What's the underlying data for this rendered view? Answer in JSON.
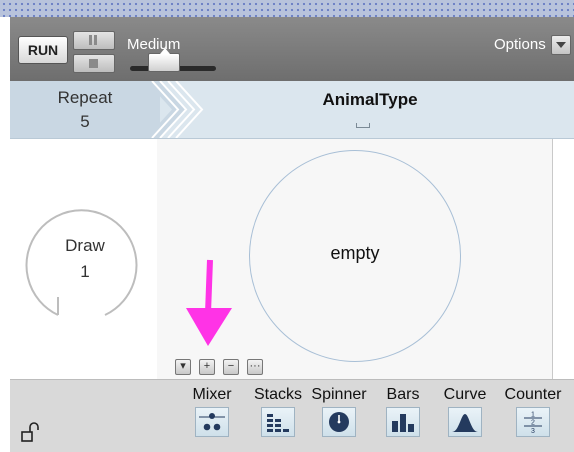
{
  "toolbar": {
    "run_label": "RUN",
    "speed_label": "Medium",
    "options_label": "Options"
  },
  "header": {
    "repeat_label": "Repeat",
    "repeat_value": "5",
    "attribute_title": "AnimalType"
  },
  "left": {
    "draw_label": "Draw",
    "draw_value": "1"
  },
  "device": {
    "content_label": "empty"
  },
  "device_buttons": [
    {
      "name": "dropdown",
      "glyph": "▾"
    },
    {
      "name": "add",
      "glyph": "+"
    },
    {
      "name": "remove",
      "glyph": "−"
    },
    {
      "name": "more",
      "glyph": "···"
    }
  ],
  "palette": {
    "items": [
      {
        "label": "Mixer",
        "icon": "mixer-icon"
      },
      {
        "label": "Stacks",
        "icon": "stacks-icon"
      },
      {
        "label": "Spinner",
        "icon": "spinner-icon"
      },
      {
        "label": "Bars",
        "icon": "bars-icon"
      },
      {
        "label": "Curve",
        "icon": "curve-icon"
      },
      {
        "label": "Counter",
        "icon": "counter-icon"
      }
    ],
    "counter_numbers": [
      "1",
      "2",
      "3"
    ]
  },
  "colors": {
    "accent_arrow": "#ff33e6",
    "header_bg": "#dbe6ee",
    "toolbar_bg": "#7c7c7c",
    "palette_icon": "#243a5e"
  }
}
